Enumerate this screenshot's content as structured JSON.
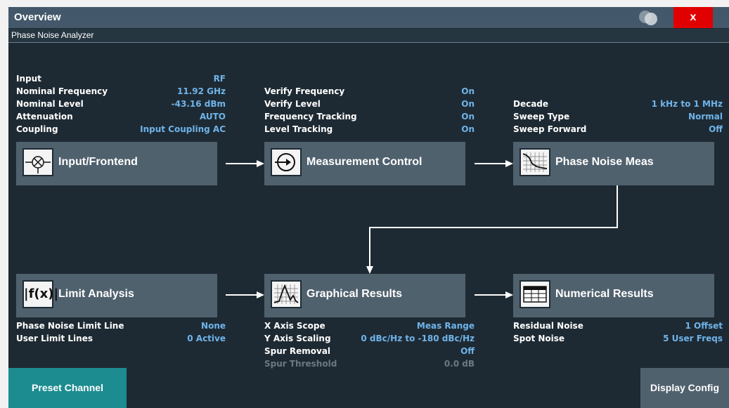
{
  "window": {
    "title": "Overview",
    "close_label": "x",
    "subtitle": "Phase Noise Analyzer"
  },
  "input_info": [
    {
      "label": "Input",
      "value": "RF"
    },
    {
      "label": "Nominal Frequency",
      "value": "11.92 GHz"
    },
    {
      "label": "Nominal Level",
      "value": "-43.16 dBm"
    },
    {
      "label": "Attenuation",
      "value": "AUTO"
    },
    {
      "label": "Coupling",
      "value": "Input Coupling AC"
    }
  ],
  "measurement_info": [
    {
      "label": "Verify Frequency",
      "value": "On"
    },
    {
      "label": "Verify Level",
      "value": "On"
    },
    {
      "label": "Frequency Tracking",
      "value": "On"
    },
    {
      "label": "Level Tracking",
      "value": "On"
    }
  ],
  "phase_noise_info": [
    {
      "label": "Decade",
      "value": "1 kHz to 1 MHz"
    },
    {
      "label": "Sweep Type",
      "value": "Normal"
    },
    {
      "label": "Sweep Forward",
      "value": "Off"
    }
  ],
  "limit_info": [
    {
      "label": "Phase Noise Limit Line",
      "value": "None"
    },
    {
      "label": "User Limit Lines",
      "value": "0 Active"
    }
  ],
  "graphical_info": [
    {
      "label": "X Axis Scope",
      "value": "Meas Range"
    },
    {
      "label": "Y Axis Scaling",
      "value": "0 dBc/Hz to -180 dBc/Hz"
    },
    {
      "label": "Spur Removal",
      "value": "Off"
    },
    {
      "label": "Spur Threshold",
      "value": "0.0 dB",
      "disabled": true
    }
  ],
  "numerical_info": [
    {
      "label": "Residual Noise",
      "value": "1 Offset"
    },
    {
      "label": "Spot Noise",
      "value": "5 User Freqs"
    }
  ],
  "blocks": {
    "input_frontend": {
      "label": "Input/Frontend",
      "icon": "mixer-icon"
    },
    "measurement_control": {
      "label": "Measurement Control",
      "icon": "arrow-circle-icon"
    },
    "phase_noise_meas": {
      "label": "Phase Noise Meas",
      "icon": "phase-noise-graph-icon"
    },
    "limit_analysis": {
      "label": "Limit Analysis",
      "icon": "function-icon",
      "icon_text": "|f(x)|"
    },
    "graphical_results": {
      "label": "Graphical Results",
      "icon": "spectrum-graph-icon"
    },
    "numerical_results": {
      "label": "Numerical Results",
      "icon": "table-icon"
    }
  },
  "buttons": {
    "preset_channel": "Preset Channel",
    "display_config": "Display Config"
  },
  "colors": {
    "title_bar": "#43586a",
    "background": "#1e2a33",
    "block": "#50616e",
    "value_text": "#6fb4ea",
    "close_button": "#e00000",
    "preset_button": "#1c8c90"
  }
}
